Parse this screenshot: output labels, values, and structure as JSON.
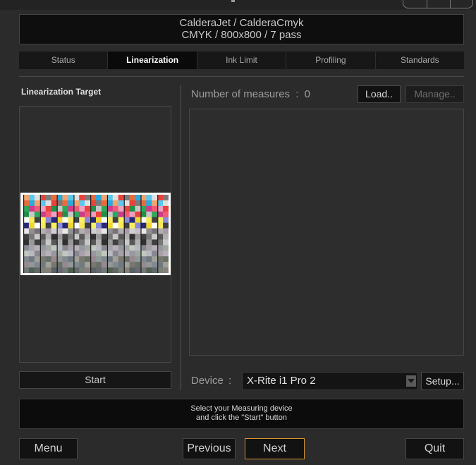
{
  "header": {
    "line1": "CalderaJet / CalderaCmyk",
    "line2": "CMYK / 800x800 / 7 pass"
  },
  "tabs": [
    {
      "label": "Status",
      "active": false
    },
    {
      "label": "Linearization",
      "active": true
    },
    {
      "label": "Ink Limit",
      "active": false
    },
    {
      "label": "Profiling",
      "active": false
    },
    {
      "label": "Standards",
      "active": false
    }
  ],
  "left": {
    "title": "Linearization Target",
    "start_label": "Start"
  },
  "measures": {
    "label": "Number of measures",
    "separator": ":",
    "count": "0",
    "load_label": "Load..",
    "manage_label": "Manage.."
  },
  "device": {
    "label": "Device",
    "separator": ":",
    "selected": "X-Rite i1 Pro 2",
    "setup_label": "Setup..."
  },
  "status": {
    "line1": "Select your Measuring device",
    "line2": "and click the \"Start\" button"
  },
  "footer": {
    "menu_label": "Menu",
    "previous_label": "Previous",
    "next_label": "Next",
    "quit_label": "Quit"
  },
  "colors": {
    "accent": "#d8922a",
    "background": "#2b2b2b"
  }
}
